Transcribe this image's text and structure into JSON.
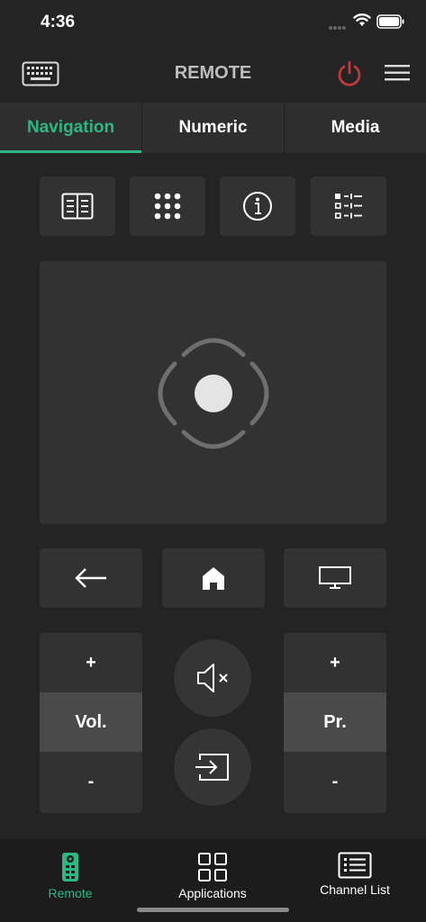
{
  "status_bar": {
    "time": "4:36"
  },
  "header": {
    "title": "REMOTE"
  },
  "tabs": [
    {
      "label": "Navigation",
      "active": true
    },
    {
      "label": "Numeric",
      "active": false
    },
    {
      "label": "Media",
      "active": false
    }
  ],
  "quick_buttons": [
    "guide-icon",
    "numpad-icon",
    "info-icon",
    "options-list-icon"
  ],
  "nav_buttons": [
    "back-arrow-icon",
    "home-icon",
    "tv-icon"
  ],
  "volume": {
    "plus": "+",
    "label": "Vol.",
    "minus": "-"
  },
  "program": {
    "plus": "+",
    "label": "Pr.",
    "minus": "-"
  },
  "bottom_nav": [
    {
      "label": "Remote",
      "active": true
    },
    {
      "label": "Applications",
      "active": false
    },
    {
      "label": "Channel List",
      "active": false
    }
  ],
  "colors": {
    "accent": "#2db883",
    "power": "#c0393b",
    "background": "#242424",
    "button": "#323232"
  }
}
